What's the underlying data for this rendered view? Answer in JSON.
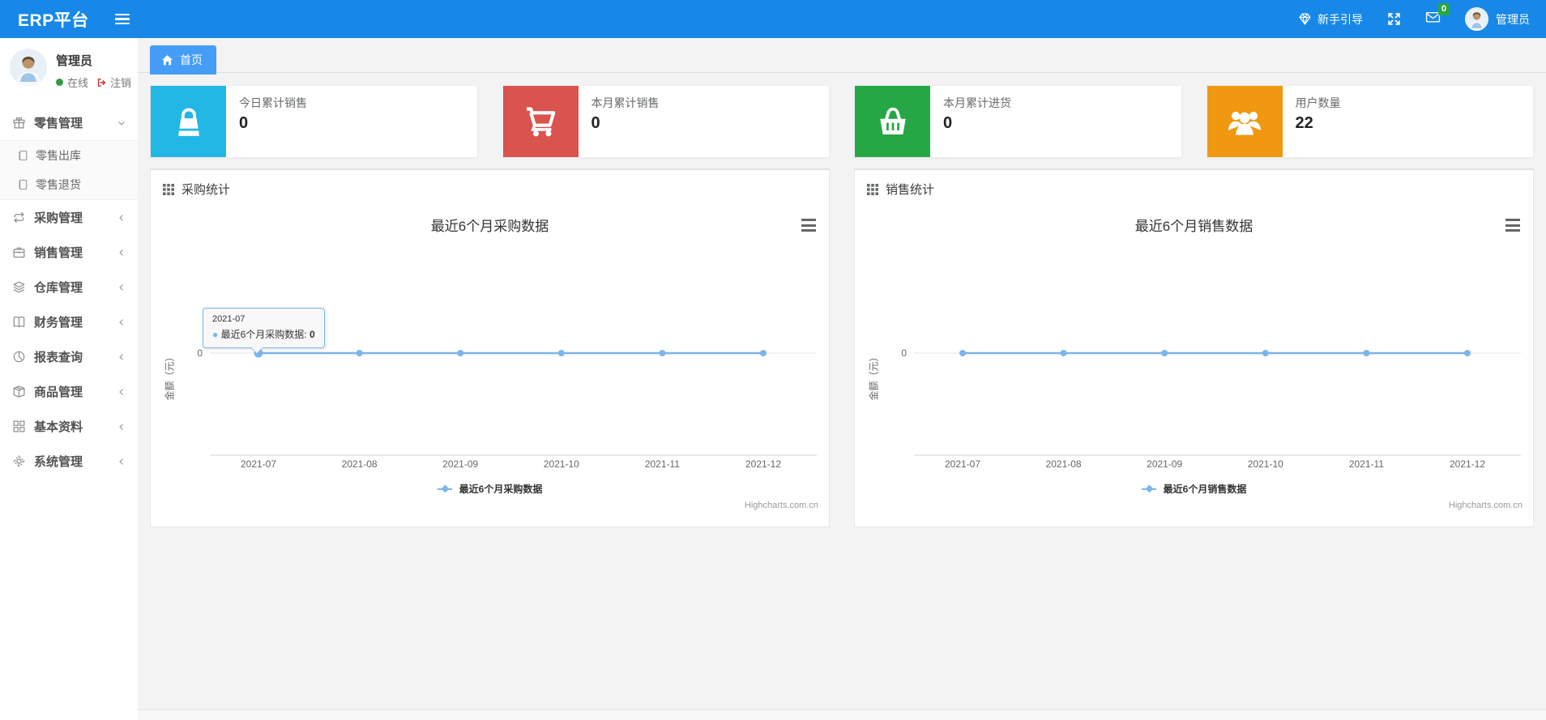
{
  "app_title": "ERP平台",
  "topbar": {
    "guide_label": "新手引导",
    "guide_icon": "gem-icon",
    "fullscreen_icon": "fullscreen-icon",
    "mail_icon": "envelope-icon",
    "mail_badge": "0",
    "username": "管理员"
  },
  "sidebar": {
    "user": {
      "name": "管理员",
      "status": "在线",
      "logout": "注销"
    },
    "menu": [
      {
        "label": "零售管理",
        "icon": "gift-icon",
        "expanded": true,
        "children": [
          {
            "label": "零售出库",
            "icon": "journal-icon"
          },
          {
            "label": "零售退货",
            "icon": "journal-icon"
          }
        ]
      },
      {
        "label": "采购管理",
        "icon": "repeat-icon"
      },
      {
        "label": "销售管理",
        "icon": "briefcase-icon"
      },
      {
        "label": "仓库管理",
        "icon": "layers-icon"
      },
      {
        "label": "财务管理",
        "icon": "book-icon"
      },
      {
        "label": "报表查询",
        "icon": "pie-chart-icon"
      },
      {
        "label": "商品管理",
        "icon": "box-icon"
      },
      {
        "label": "基本资料",
        "icon": "grid-icon"
      },
      {
        "label": "系统管理",
        "icon": "gear-icon"
      }
    ]
  },
  "tab_home": "首页",
  "stats": [
    {
      "title": "今日累计销售",
      "value": "0",
      "color": "#23b7e5",
      "icon": "shopping-bag-icon"
    },
    {
      "title": "本月累计销售",
      "value": "0",
      "color": "#d9534f",
      "icon": "shopping-cart-icon"
    },
    {
      "title": "本月累计进货",
      "value": "0",
      "color": "#26a745",
      "icon": "shopping-basket-icon"
    },
    {
      "title": "用户数量",
      "value": "22",
      "color": "#f0980f",
      "icon": "users-icon"
    }
  ],
  "panels": [
    {
      "header": "采购统计",
      "icon": "grid-3x3-icon"
    },
    {
      "header": "销售统计",
      "icon": "grid-3x3-icon"
    }
  ],
  "chart_data": [
    {
      "type": "line",
      "title": "最近6个月采购数据",
      "categories": [
        "2021-07",
        "2021-08",
        "2021-09",
        "2021-10",
        "2021-11",
        "2021-12"
      ],
      "series": [
        {
          "name": "最近6个月采购数据",
          "values": [
            0,
            0,
            0,
            0,
            0,
            0
          ]
        }
      ],
      "ylabel": "金额（元）",
      "yticks": [
        "0"
      ],
      "color": "#7cb5ec",
      "grid": true,
      "legend_position": "bottom",
      "tooltip": {
        "date": "2021-07",
        "label": "最近6个月采购数据",
        "value": "0",
        "point_index": 0
      }
    },
    {
      "type": "line",
      "title": "最近6个月销售数据",
      "categories": [
        "2021-07",
        "2021-08",
        "2021-09",
        "2021-10",
        "2021-11",
        "2021-12"
      ],
      "series": [
        {
          "name": "最近6个月销售数据",
          "values": [
            0,
            0,
            0,
            0,
            0,
            0
          ]
        }
      ],
      "ylabel": "金额（元）",
      "yticks": [
        "0"
      ],
      "color": "#7cb5ec",
      "grid": true,
      "legend_position": "bottom"
    }
  ],
  "credits": "Highcharts.com.cn"
}
